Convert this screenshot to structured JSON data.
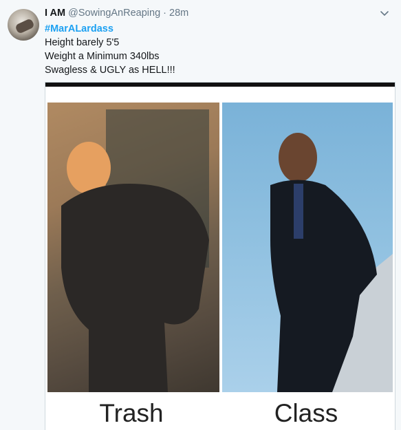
{
  "tweet": {
    "name": "I AM",
    "handle": "@SowingAnReaping",
    "separator": "·",
    "time": "28m",
    "hashtag": "#MarALardass",
    "lines": [
      "Height barely 5'5",
      "Weight a Minimum 340lbs",
      "Swagless & UGLY as HELL!!!"
    ]
  },
  "media": {
    "caption_left": "Trash",
    "caption_right": "Class"
  },
  "icons": {
    "menu": "chevron-down-icon"
  },
  "colors": {
    "background": "#f5f8fa",
    "link": "#1da1f2",
    "muted": "#657786"
  }
}
